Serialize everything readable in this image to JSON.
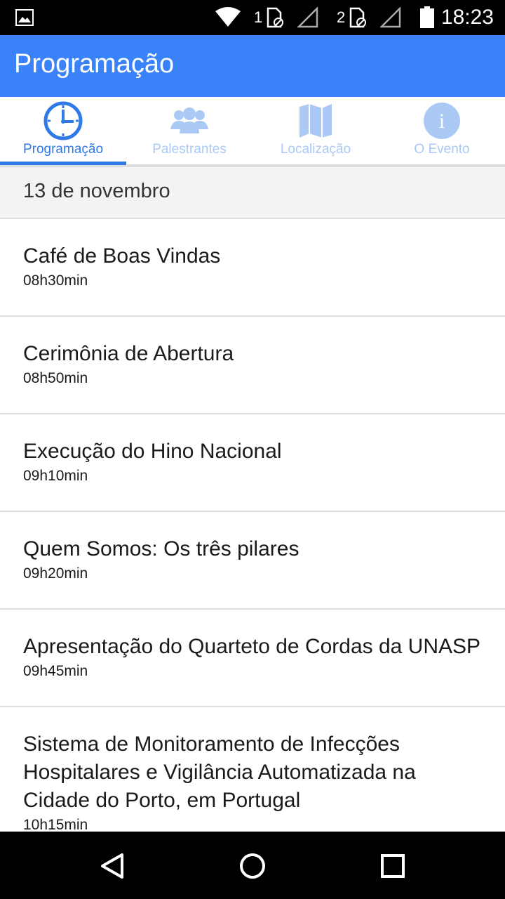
{
  "status_bar": {
    "time": "18:23",
    "sim1_label": "1",
    "sim2_label": "2"
  },
  "app_bar": {
    "title": "Programação"
  },
  "tabs": [
    {
      "label": "Programação",
      "icon": "clock-icon",
      "active": true
    },
    {
      "label": "Palestrantes",
      "icon": "people-icon",
      "active": false
    },
    {
      "label": "Localização",
      "icon": "map-icon",
      "active": false
    },
    {
      "label": "O Evento",
      "icon": "info-icon",
      "active": false
    }
  ],
  "section": {
    "date": "13 de novembro"
  },
  "items": [
    {
      "title": "Café de Boas Vindas",
      "time": "08h30min"
    },
    {
      "title": "Cerimônia de Abertura",
      "time": "08h50min"
    },
    {
      "title": "Execução do Hino Nacional",
      "time": "09h10min"
    },
    {
      "title": "Quem Somos: Os três pilares",
      "time": "09h20min"
    },
    {
      "title": "Apresentação do Quarteto de Cordas da UNASP",
      "time": "09h45min"
    },
    {
      "title": "Sistema de Monitoramento de Infecções Hospitalares e Vigilância Automatizada na Cidade do Porto, em Portugal",
      "time": "10h15min"
    }
  ],
  "colors": {
    "primary": "#3a82f7",
    "tab_active": "#2f7ae9",
    "tab_inactive": "#aac9f5"
  }
}
